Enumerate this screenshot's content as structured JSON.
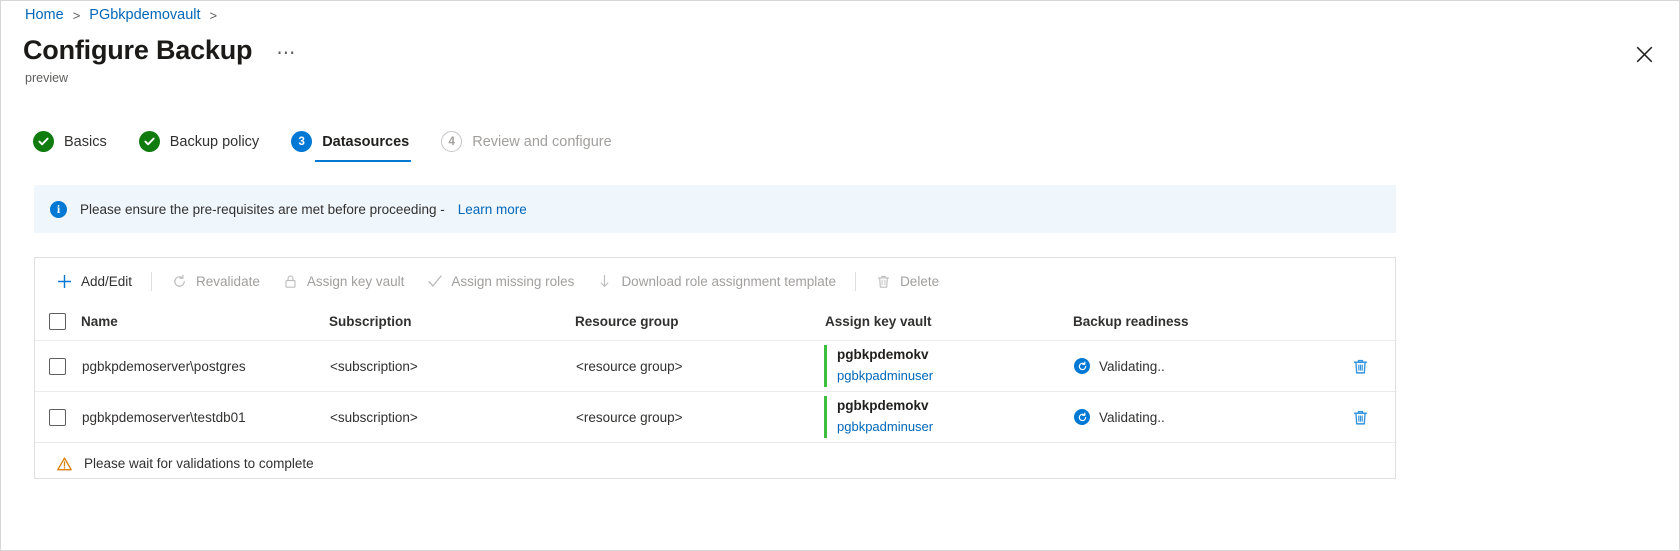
{
  "breadcrumb": {
    "items": [
      {
        "label": "Home"
      },
      {
        "label": "PGbkpdemovault"
      }
    ],
    "separator": ">"
  },
  "header": {
    "title": "Configure Backup",
    "ellipsis": "⋯",
    "preview_label": "preview",
    "close_icon": "close-icon"
  },
  "wizard": {
    "steps": [
      {
        "number": "1",
        "label": "Basics",
        "state": "completed"
      },
      {
        "number": "2",
        "label": "Backup policy",
        "state": "completed"
      },
      {
        "number": "3",
        "label": "Datasources",
        "state": "active"
      },
      {
        "number": "4",
        "label": "Review and configure",
        "state": "upcoming"
      }
    ]
  },
  "info_banner": {
    "icon": "info-icon",
    "text": "Please ensure the pre-requisites are met before proceeding -",
    "link": "Learn more"
  },
  "toolbar": {
    "buttons": [
      {
        "label": "Add/Edit",
        "icon": "plus-icon",
        "enabled": true
      },
      {
        "label": "Revalidate",
        "icon": "refresh-icon",
        "enabled": false
      },
      {
        "label": "Assign key vault",
        "icon": "lock-icon",
        "enabled": false
      },
      {
        "label": "Assign missing roles",
        "icon": "check-icon",
        "enabled": false
      },
      {
        "label": "Download role assignment template",
        "icon": "download-icon",
        "enabled": false
      },
      {
        "label": "Delete",
        "icon": "trash-icon",
        "enabled": false
      }
    ]
  },
  "table": {
    "select_all_checkbox": "unchecked",
    "columns": [
      "Name",
      "Subscription",
      "Resource group",
      "Assign key vault",
      "Backup readiness"
    ],
    "rows": [
      {
        "checked": false,
        "name": "pgbkpdemoserver\\postgres",
        "subscription": "<subscription>",
        "resource_group": "<resource group>",
        "key_vault": "pgbkpdemokv",
        "key_vault_user": "pgbkpadminuser",
        "readiness": "Validating..",
        "readiness_icon": "sync-icon",
        "delete_icon": "trash-icon"
      },
      {
        "checked": false,
        "name": "pgbkpdemoserver\\testdb01",
        "subscription": "<subscription>",
        "resource_group": "<resource group>",
        "key_vault": "pgbkpdemokv",
        "key_vault_user": "pgbkpadminuser",
        "readiness": "Validating..",
        "readiness_icon": "sync-icon",
        "delete_icon": "trash-icon"
      }
    ]
  },
  "footer": {
    "icon": "warning-icon",
    "text": "Please wait for validations to complete"
  },
  "colors": {
    "link": "#0067b8",
    "accent": "#0078d4",
    "success": "#107c10",
    "keyvault_bar": "#3dbf3d",
    "warning": "#d8800a",
    "banner_bg": "#eff6fc"
  }
}
